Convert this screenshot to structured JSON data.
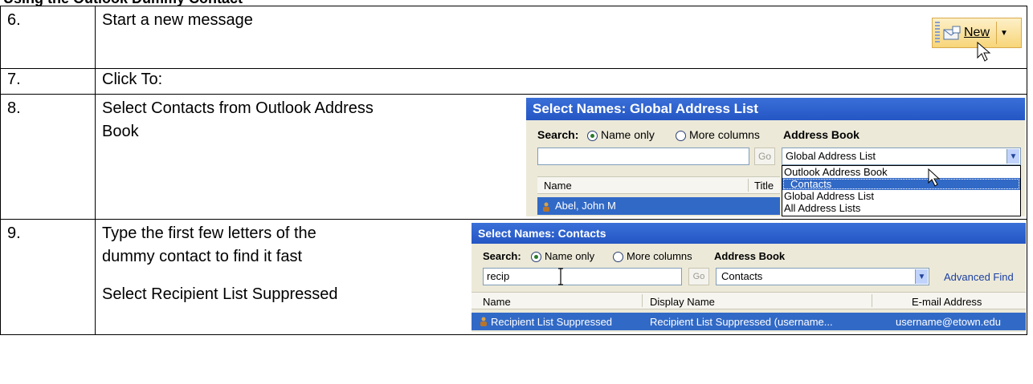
{
  "page_heading": "Using the Outlook Dummy Contact",
  "steps": [
    {
      "number": "6.",
      "text": "Start a new message"
    },
    {
      "number": "7.",
      "text": "Click To:"
    },
    {
      "number": "8.",
      "text_line1": "Select Contacts from Outlook Address",
      "text_line2": "Book"
    },
    {
      "number": "9.",
      "text_line1": "Type the first few letters of the",
      "text_line2": "dummy contact to find it fast",
      "text_line3": "Select Recipient List Suppressed"
    }
  ],
  "new_button": {
    "label": "New",
    "icon": "new-message-icon"
  },
  "dialog_global": {
    "title": "Select Names: Global Address List",
    "search_label": "Search:",
    "radio_name_only": "Name only",
    "radio_more_columns": "More columns",
    "address_book_label": "Address Book",
    "search_value": "",
    "go_label": "Go",
    "address_book_selected": "Global Address List",
    "dropdown_options": [
      "Outlook Address Book",
      "Contacts",
      "Global Address List",
      "All Address Lists"
    ],
    "col_name": "Name",
    "col_title": "Title",
    "row_name": "Abel, John M"
  },
  "dialog_contacts": {
    "title": "Select Names: Contacts",
    "search_label": "Search:",
    "radio_name_only": "Name only",
    "radio_more_columns": "More columns",
    "address_book_label": "Address Book",
    "search_value": "recip",
    "go_label": "Go",
    "address_book_selected": "Contacts",
    "advanced_find": "Advanced Find",
    "col_name": "Name",
    "col_display": "Display Name",
    "col_email": "E-mail Address",
    "row_name": "Recipient List Suppressed",
    "row_display": "Recipient List Suppressed (username...",
    "row_email": "username@etown.edu"
  },
  "colors": {
    "title_bar": "#2456c4",
    "selection": "#3169c6",
    "dialog_bg": "#ece9d8",
    "new_button_bg": "#f7d579"
  }
}
